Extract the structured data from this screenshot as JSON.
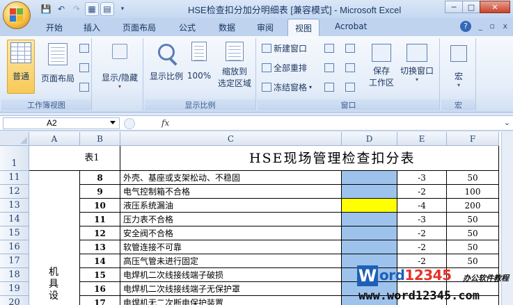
{
  "window": {
    "title": "HSE检查扣分加分明细表  [兼容模式] - Microsoft Excel",
    "min": "─",
    "max": "□",
    "close": "✕"
  },
  "tabs": [
    {
      "label": "开始"
    },
    {
      "label": "插入"
    },
    {
      "label": "页面布局"
    },
    {
      "label": "公式"
    },
    {
      "label": "数据"
    },
    {
      "label": "审阅"
    },
    {
      "label": "视图"
    },
    {
      "label": "Acrobat"
    }
  ],
  "active_tab": "视图",
  "help": "?",
  "ribbon_ctrls": [
    "_",
    "▫",
    "x"
  ],
  "ribbon": {
    "workbook_views": {
      "label": "工作簿视图",
      "normal": "普通",
      "page_layout": "页面布局"
    },
    "show_hide": {
      "label": "显示/隐藏"
    },
    "zoom": {
      "label": "显示比例",
      "zoom": "显示比例",
      "hundred": "100%",
      "zoom_sel_1": "缩放到",
      "zoom_sel_2": "选定区域"
    },
    "window": {
      "label": "窗口",
      "new_window": "新建窗口",
      "arrange_all": "全部重排",
      "freeze": "冻结窗格",
      "save_ws_1": "保存",
      "save_ws_2": "工作区",
      "switch_win": "切换窗口"
    },
    "macros": {
      "label": "宏",
      "macro": "宏"
    }
  },
  "formula_bar": {
    "name_box": "A2",
    "fx": "fx",
    "formula": ""
  },
  "columns": [
    "A",
    "B",
    "C",
    "D",
    "E",
    "F"
  ],
  "sheet": {
    "row1": {
      "num": "1",
      "b": "表1",
      "title": "HSE现场管理检查扣分表"
    },
    "rows": [
      {
        "num": "11",
        "idx": "8",
        "item": "外壳、基座或支架松动、不稳固",
        "e": "-3",
        "f": "50"
      },
      {
        "num": "12",
        "idx": "9",
        "item": "电气控制箱不合格",
        "e": "-2",
        "f": "100"
      },
      {
        "num": "13",
        "idx": "10",
        "item": "液压系统漏油",
        "e": "-4",
        "f": "200"
      },
      {
        "num": "14",
        "idx": "11",
        "item": "压力表不合格",
        "e": "-3",
        "f": "50"
      },
      {
        "num": "15",
        "idx": "12",
        "item": "安全阀不合格",
        "e": "-2",
        "f": "50"
      },
      {
        "num": "16",
        "idx": "13",
        "item": "软管连接不可靠",
        "e": "-2",
        "f": "50"
      },
      {
        "num": "17",
        "idx": "14",
        "item": "高压气管未进行固定",
        "e": "-2",
        "f": "50"
      },
      {
        "num": "18",
        "idx": "15",
        "item": "电焊机二次线接线端子破损",
        "e": "",
        "f": ""
      },
      {
        "num": "19",
        "idx": "16",
        "item": "电焊机二次线接线端子无保护罩",
        "e": "",
        "f": ""
      },
      {
        "num": "20",
        "idx": "17",
        "item": "电焊机无二次断电保护装置",
        "e": "",
        "f": ""
      }
    ],
    "merged_a_text": [
      "机",
      "具",
      "设"
    ]
  },
  "colors": {
    "d_fill": "#9dc3ec",
    "highlight": "#ffff00"
  },
  "watermark": {
    "w": "W",
    "ord": "ord",
    "num": "12345",
    "tag": "办公软件教程",
    "url": "www.word12345.com"
  }
}
